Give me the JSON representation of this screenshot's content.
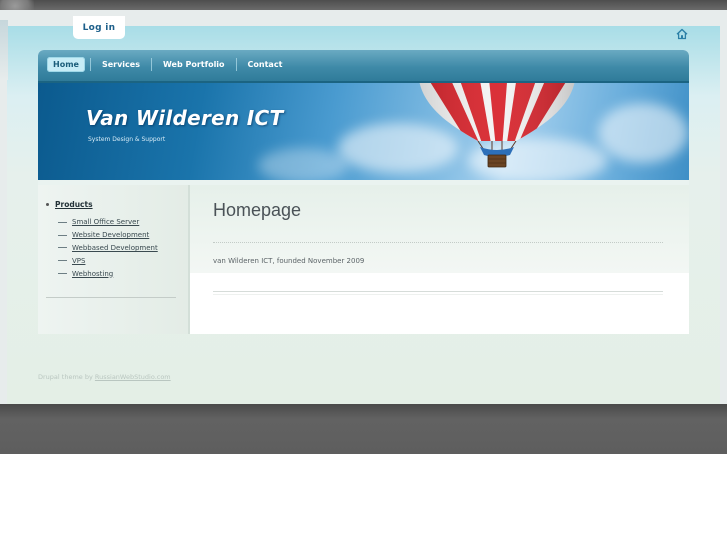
{
  "header": {
    "login_label": "Log in",
    "home_icon": "home-icon"
  },
  "nav": {
    "items": [
      {
        "label": "Home",
        "active": true
      },
      {
        "label": "Services",
        "active": false
      },
      {
        "label": "Web Portfolio",
        "active": false
      },
      {
        "label": "Contact",
        "active": false
      }
    ]
  },
  "banner": {
    "title": "Van Wilderen ICT",
    "slogan": "System Design & Support",
    "image_icon": "hot-air-balloon"
  },
  "sidebar": {
    "heading": "Products",
    "items": [
      "Small Office Server",
      "Website Development",
      "Webbased Development",
      "VPS",
      "Webhosting"
    ]
  },
  "content": {
    "title": "Homepage",
    "text": "van Wilderen ICT, founded November 2009"
  },
  "footer": {
    "prefix": "Drupal theme by",
    "link": "RussianWebStudio.com"
  },
  "colors": {
    "nav_bar": "#3f8aa8",
    "nav_active": "#c6ecf6",
    "link_blue": "#1d5f8a",
    "page_bg": "#e4efe6",
    "dark_band": "#5e5e5e"
  }
}
